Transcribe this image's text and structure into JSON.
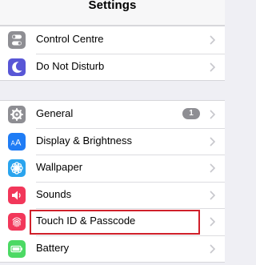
{
  "header": {
    "title": "Settings"
  },
  "groups": [
    {
      "rows": [
        {
          "label": "Control Centre",
          "icon": "toggles-icon",
          "icon_color": "#8e8e93"
        },
        {
          "label": "Do Not Disturb",
          "icon": "moon-icon",
          "icon_color": "#5856d6"
        }
      ]
    },
    {
      "rows": [
        {
          "label": "General",
          "icon": "gear-icon",
          "icon_color": "#8e8e93",
          "badge": "1"
        },
        {
          "label": "Display & Brightness",
          "icon": "text-size-icon",
          "icon_color": "#1f7cf5"
        },
        {
          "label": "Wallpaper",
          "icon": "flower-icon",
          "icon_color": "#2aa4ee"
        },
        {
          "label": "Sounds",
          "icon": "speaker-icon",
          "icon_color": "#f2375a"
        },
        {
          "label": "Touch ID & Passcode",
          "icon": "fingerprint-icon",
          "icon_color": "#f2375a",
          "highlighted": true
        },
        {
          "label": "Battery",
          "icon": "battery-icon",
          "icon_color": "#4cd964"
        }
      ]
    }
  ],
  "colors": {
    "highlight_border": "#d0202a",
    "badge": "#8e8e93",
    "chevron": "#c7c7cc"
  }
}
